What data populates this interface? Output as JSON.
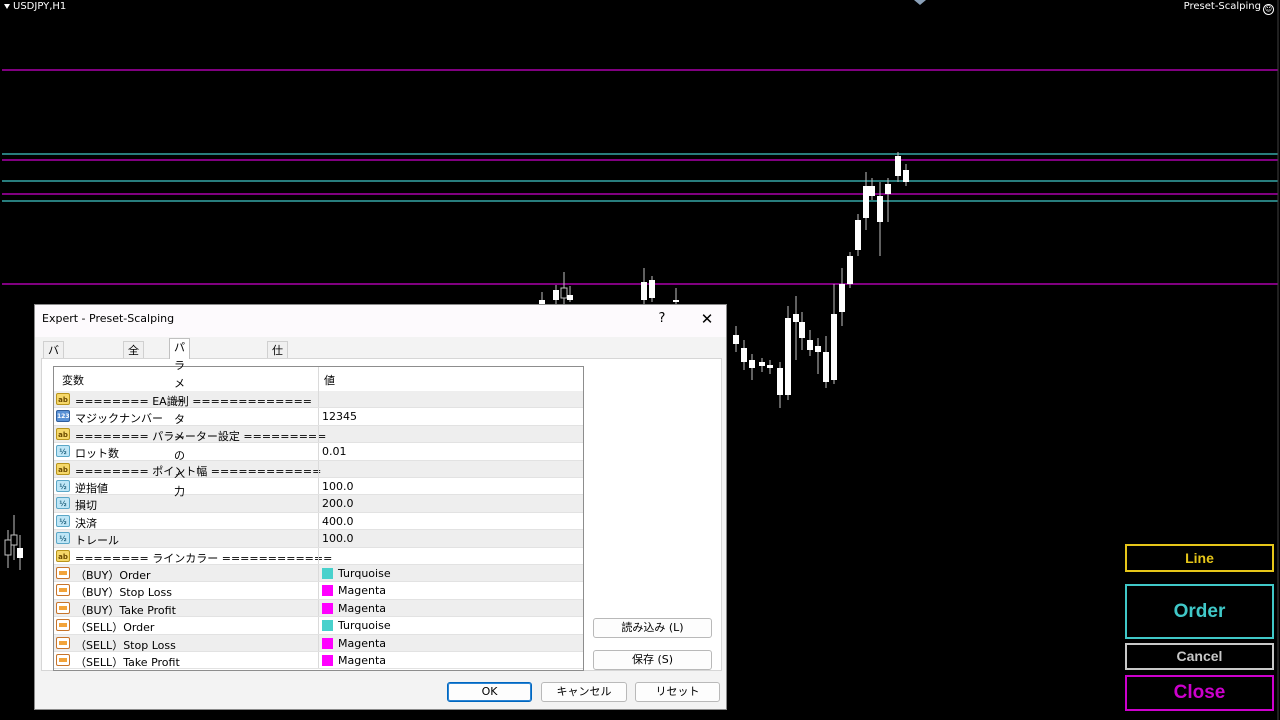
{
  "chart": {
    "symbol": "USDJPY,H1",
    "ea_name": "Preset-Scalping",
    "colors": {
      "magenta": "#cc00cc",
      "turquoise": "#40c8c8",
      "candle": "#ffffff",
      "wick": "#c0c0c0"
    }
  },
  "dialog": {
    "title": "Expert - Preset-Scalping",
    "help_label": "?",
    "close_label": "✕",
    "tabs": [
      "バージョン情報",
      "全般",
      "パラメーターの入力",
      "仕様"
    ],
    "active_tab": 2,
    "columns": {
      "variable": "変数",
      "value": "値"
    },
    "rows": [
      {
        "icon": "ab",
        "name": "======== EA識別 =============",
        "value": ""
      },
      {
        "icon": "123",
        "name": "マジックナンバー",
        "value": "12345"
      },
      {
        "icon": "ab",
        "name": "======== パラメーター設定 =========",
        "value": ""
      },
      {
        "icon": "half",
        "name": "ロット数",
        "value": "0.01"
      },
      {
        "icon": "ab",
        "name": "======== ポイント幅 ============",
        "value": ""
      },
      {
        "icon": "half",
        "name": "逆指値",
        "value": "100.0"
      },
      {
        "icon": "half",
        "name": "損切",
        "value": "200.0"
      },
      {
        "icon": "half",
        "name": "決済",
        "value": "400.0"
      },
      {
        "icon": "half",
        "name": "トレール",
        "value": "100.0"
      },
      {
        "icon": "ab",
        "name": "======== ラインカラー ============",
        "value": ""
      },
      {
        "icon": "color",
        "name": "（BUY）Order",
        "value": "Turquoise",
        "swatch": "#48d1cc"
      },
      {
        "icon": "color",
        "name": "（BUY）Stop Loss",
        "value": "Magenta",
        "swatch": "#ff00ff"
      },
      {
        "icon": "color",
        "name": "（BUY）Take Profit",
        "value": "Magenta",
        "swatch": "#ff00ff"
      },
      {
        "icon": "color",
        "name": "（SELL）Order",
        "value": "Turquoise",
        "swatch": "#48d1cc"
      },
      {
        "icon": "color",
        "name": "（SELL）Stop Loss",
        "value": "Magenta",
        "swatch": "#ff00ff"
      },
      {
        "icon": "color",
        "name": "（SELL）Take Profit",
        "value": "Magenta",
        "swatch": "#ff00ff"
      }
    ],
    "load_label": "読み込み (L)",
    "save_label": "保存 (S)",
    "ok_label": "OK",
    "cancel_label": "キャンセル",
    "reset_label": "リセット"
  },
  "trade_panel": {
    "line_label": "Line",
    "order_label": "Order",
    "cancel_label": "Cancel",
    "close_label": "Close",
    "colors": {
      "line": "#e6c619",
      "order": "#40c8c8",
      "cancel": "#c8c8c8",
      "close": "#cc00cc"
    }
  }
}
